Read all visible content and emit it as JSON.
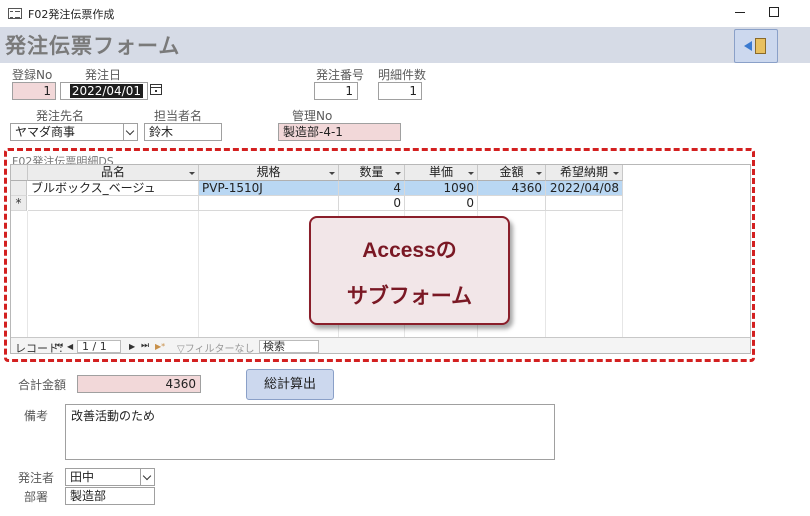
{
  "window": {
    "title": "F02発注伝票作成"
  },
  "form": {
    "title": "発注伝票フォーム"
  },
  "header": {
    "reg_no_label": "登録No",
    "reg_no": "1",
    "order_date_label": "発注日",
    "order_date": "2022/04/01",
    "order_no_label": "発注番号",
    "order_no": "1",
    "detail_count_label": "明細件数",
    "detail_count": "1",
    "supplier_label": "発注先名",
    "supplier": "ヤマダ商事",
    "person_label": "担当者名",
    "person": "鈴木",
    "mgmt_no_label": "管理No",
    "mgmt_no": "製造部-4-1"
  },
  "subform": {
    "title": "F02発注伝票明細DS",
    "columns": [
      "品名",
      "規格",
      "数量",
      "単価",
      "金額",
      "希望納期"
    ],
    "rows": [
      [
        "ブルボックス_ベージュ",
        "PVP-1510J",
        "4",
        "1090",
        "4360",
        "2022/04/08"
      ]
    ],
    "new_row": {
      "marker": "*",
      "qty": "0",
      "price": "0"
    },
    "navigation": {
      "record_label": "レコード:",
      "first": "⏮",
      "prev": "◀",
      "position": "1 / 1",
      "next": "▶",
      "last": "⏭",
      "new": "▶*",
      "filter": "フィルターなし",
      "search": "検索"
    }
  },
  "callout": {
    "line1": "Accessの",
    "line2": "サブフォーム"
  },
  "footer": {
    "total_label": "合計金額",
    "total": "4360",
    "calc_button": "総計算出",
    "remarks_label": "備考",
    "remarks": "改善活動のため",
    "orderer_label": "発注者",
    "orderer": "田中",
    "dept_label": "部署",
    "dept": "製造部"
  },
  "colors": {
    "header_band": "#d6dbe6",
    "pink_field": "#f2d8d9",
    "selected_row": "#b9d7f3",
    "highlight_border": "#d32020",
    "callout_text": "#7a1824"
  }
}
